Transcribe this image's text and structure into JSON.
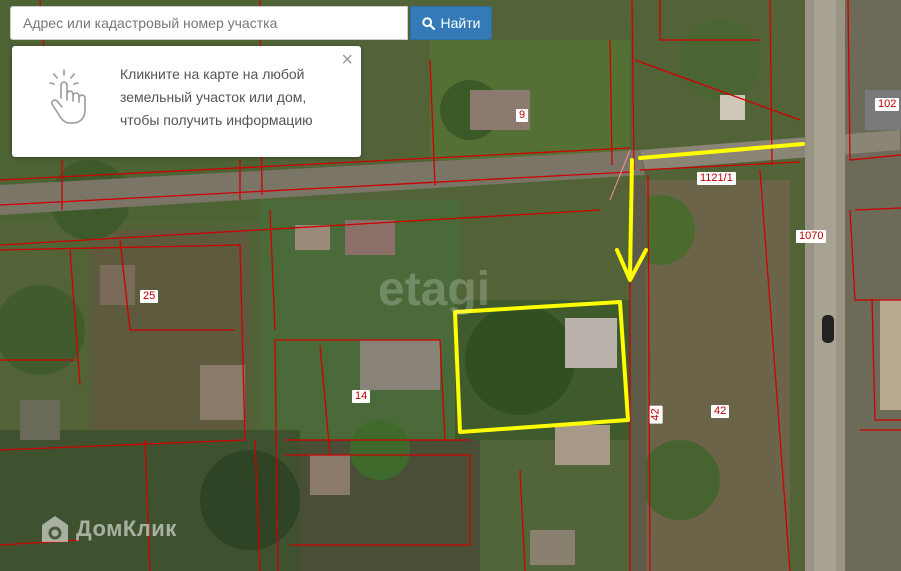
{
  "search": {
    "placeholder": "Адрес или кадастровый номер участка",
    "button_label": "Найти"
  },
  "info_panel": {
    "line1": "Кликните на карте на любой",
    "line2": "земельный участок или дом,",
    "line3": "чтобы получить информацию",
    "close": "×"
  },
  "plot_labels": {
    "l102": "102",
    "l9": "9",
    "l1121": "1121/1",
    "l1070": "1070",
    "l25": "25",
    "l14": "14",
    "l42a": "42",
    "l42b": "42"
  },
  "brand": {
    "name": "ДомКлик"
  },
  "watermark": "etagi",
  "colors": {
    "boundary": "#d00000",
    "highlight": "#ffff00",
    "button": "#337ab7"
  }
}
